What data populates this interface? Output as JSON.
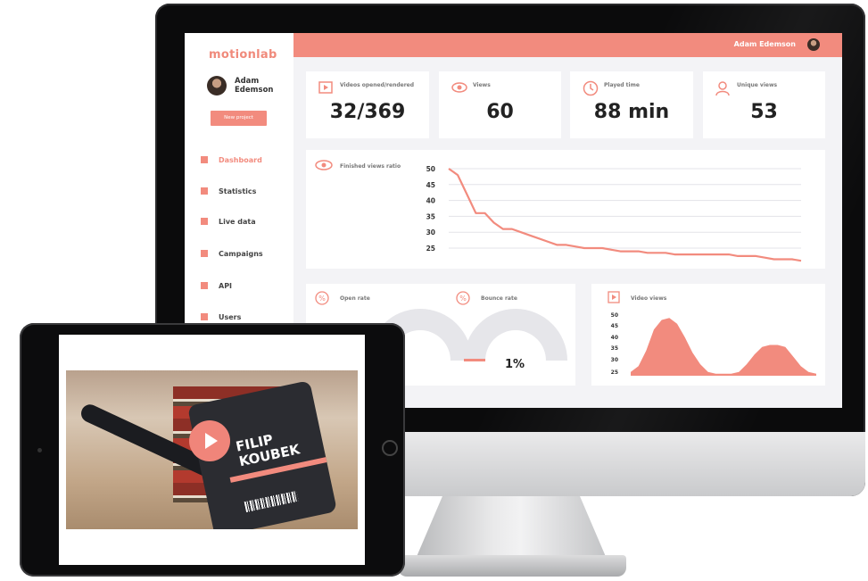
{
  "app": {
    "logo": "motionlab",
    "user_name": "Adam Edemson",
    "new_project_label": "New project"
  },
  "sidebar": {
    "items": [
      {
        "label": "Dashboard",
        "active": true
      },
      {
        "label": "Statistics",
        "active": false
      },
      {
        "label": "Live data",
        "active": false
      },
      {
        "label": "Campaigns",
        "active": false
      },
      {
        "label": "API",
        "active": false
      },
      {
        "label": "Users",
        "active": false
      }
    ]
  },
  "header": {
    "user_name": "Adam Edemson"
  },
  "stats": [
    {
      "label": "Videos opened/rendered",
      "value": "32/369",
      "icon": "play-icon"
    },
    {
      "label": "Views",
      "value": "60",
      "icon": "eye-icon"
    },
    {
      "label": "Played time",
      "value": "88 min",
      "icon": "clock-icon"
    },
    {
      "label": "Unique views",
      "value": "53",
      "icon": "user-icon"
    }
  ],
  "finished_views": {
    "label": "Finished views ratio",
    "icon": "eye-icon"
  },
  "rates": {
    "open": {
      "label": "Open rate",
      "icon": "percent-icon"
    },
    "bounce": {
      "label": "Bounce rate",
      "value": "1%",
      "icon": "percent-icon"
    }
  },
  "video_views": {
    "label": "Video views",
    "icon": "play-icon"
  },
  "colors": {
    "accent": "#f28b7e",
    "text": "#222222",
    "background": "#f3f3f6"
  },
  "tablet": {
    "badge_name_line1": "FILIP",
    "badge_name_line2": "KOUBEK"
  },
  "chart_data": [
    {
      "type": "line",
      "ylim": [
        25,
        50
      ],
      "yticks": [
        50,
        45,
        40,
        35,
        30,
        25
      ],
      "x": [
        0,
        1,
        2,
        3,
        4,
        5,
        6,
        7,
        8,
        9,
        10,
        11,
        12,
        13,
        14,
        15,
        16,
        17,
        18,
        19,
        20,
        21,
        22,
        23,
        24,
        25,
        26,
        27,
        28,
        29,
        30,
        31,
        32,
        33,
        34,
        35,
        36,
        37,
        38,
        39
      ],
      "values": [
        50,
        48,
        42,
        36,
        36,
        33,
        31,
        31,
        30,
        29,
        28,
        27,
        26,
        26,
        25.5,
        25,
        25,
        25,
        24.5,
        24,
        24,
        24,
        23.5,
        23.5,
        23.5,
        23,
        23,
        23,
        23,
        23,
        23,
        23,
        22.5,
        22.5,
        22.5,
        22,
        21.5,
        21.5,
        21.5,
        21
      ]
    },
    {
      "type": "area",
      "yticks": [
        50,
        45,
        40,
        35,
        30,
        25
      ],
      "x": [
        0,
        1,
        2,
        3,
        4,
        5,
        6,
        7,
        8,
        9,
        10,
        11,
        12,
        13,
        14,
        15,
        16,
        17,
        18,
        19,
        20,
        21,
        22,
        23,
        24
      ],
      "values": [
        22,
        25,
        33,
        44,
        49,
        50,
        47,
        40,
        32,
        26,
        22,
        21,
        21,
        21,
        22,
        26,
        31,
        35,
        36,
        36,
        35,
        30,
        25,
        22,
        21
      ]
    }
  ]
}
